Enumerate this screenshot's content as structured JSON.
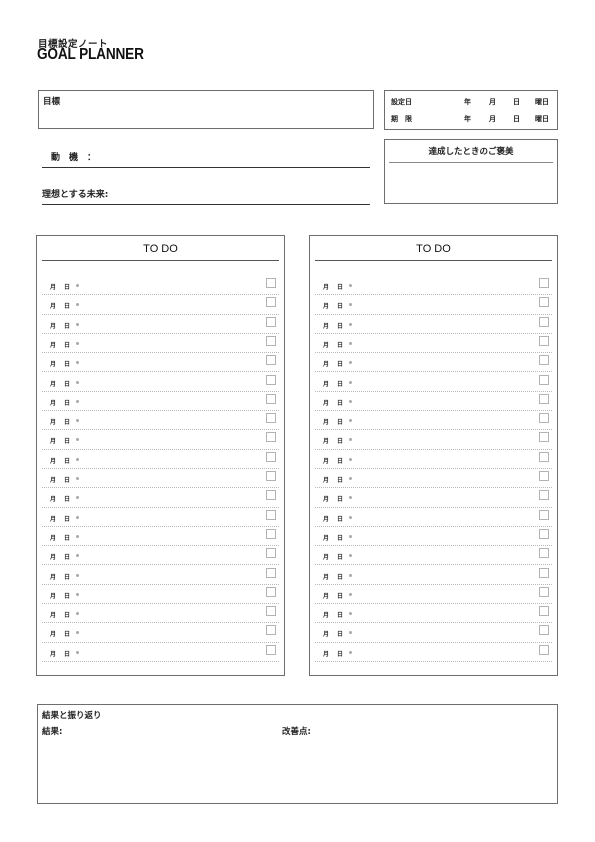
{
  "header": {
    "subtitle": "目標設定ノート",
    "title": "GOAL PLANNER"
  },
  "goal": {
    "label": "目標"
  },
  "dates": {
    "rows": [
      {
        "label": "設定日",
        "year": "年",
        "month": "月",
        "day": "日",
        "weekday": "曜日"
      },
      {
        "label": "期　限",
        "year": "年",
        "month": "月",
        "day": "日",
        "weekday": "曜日"
      }
    ]
  },
  "motivation": {
    "label": "　動　機　："
  },
  "ideal_future": {
    "label": "理想とする未来:"
  },
  "reward": {
    "label": "達成したときのご褒美"
  },
  "todo_columns": [
    {
      "title": "TO DO",
      "row_count": 20,
      "month_label": "月",
      "day_label": "日"
    },
    {
      "title": "TO DO",
      "row_count": 20,
      "month_label": "月",
      "day_label": "日"
    }
  ],
  "review": {
    "title": "結果と振り返り",
    "result_label": "結果:",
    "improvement_label": "改善点:"
  },
  "colors": {
    "border": "#6e6e6e",
    "dotted_rule": "#b8b8b8",
    "checkbox": "#b3b3b3",
    "text": "#222222"
  }
}
